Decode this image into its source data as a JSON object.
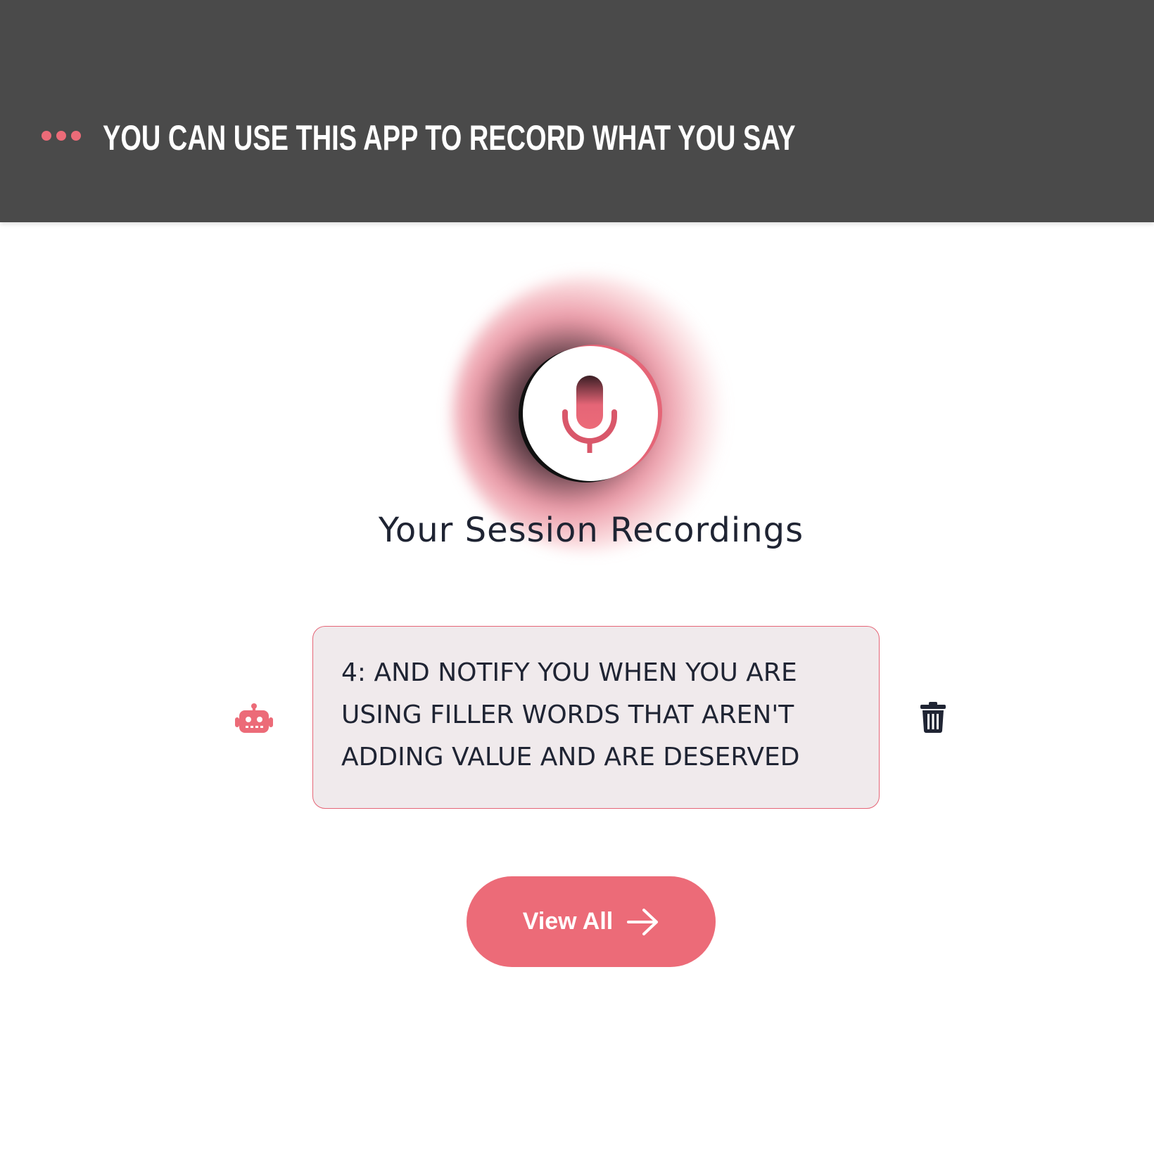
{
  "colors": {
    "accent": "#ec6b78",
    "header_bg": "#4a4a4a",
    "text_dark": "#1f2433",
    "card_bg": "#f0eaec"
  },
  "header": {
    "menu_icon": "dots-icon",
    "title": "YOU CAN USE THIS APP TO RECORD WHAT YOU SAY"
  },
  "recorder": {
    "icon": "microphone-icon"
  },
  "main": {
    "section_title": "Your Session Recordings",
    "recordings": [
      {
        "icon": "robot-icon",
        "text": "4: AND NOTIFY YOU WHEN YOU ARE USING FILLER WORDS THAT AREN'T ADDING VALUE AND ARE DESERVED",
        "action_icon": "trash-icon"
      }
    ],
    "view_all_label": "View All",
    "view_all_icon": "arrow-right-icon"
  }
}
